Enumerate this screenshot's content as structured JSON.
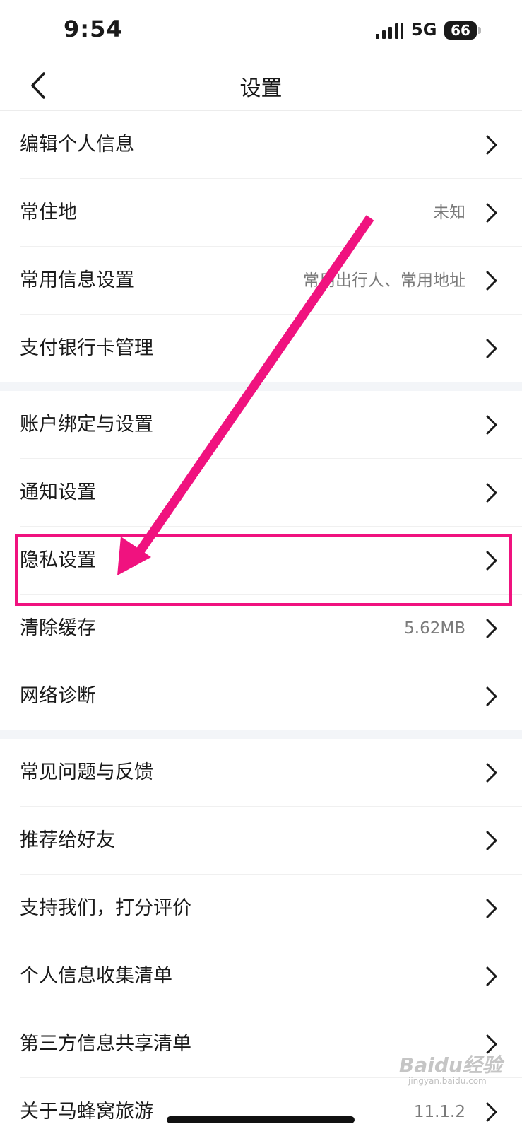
{
  "status_bar": {
    "time": "9:54",
    "network": "5G",
    "battery": "66"
  },
  "header": {
    "title": "设置"
  },
  "groups": [
    [
      {
        "label": "编辑个人信息",
        "value": ""
      },
      {
        "label": "常住地",
        "value": "未知"
      },
      {
        "label": "常用信息设置",
        "value": "常用出行人、常用地址"
      },
      {
        "label": "支付银行卡管理",
        "value": ""
      }
    ],
    [
      {
        "label": "账户绑定与设置",
        "value": ""
      },
      {
        "label": "通知设置",
        "value": ""
      },
      {
        "label": "隐私设置",
        "value": ""
      },
      {
        "label": "清除缓存",
        "value": "5.62MB"
      },
      {
        "label": "网络诊断",
        "value": ""
      }
    ],
    [
      {
        "label": "常见问题与反馈",
        "value": ""
      },
      {
        "label": "推荐给好友",
        "value": ""
      },
      {
        "label": "支持我们，打分评价",
        "value": ""
      },
      {
        "label": "个人信息收集清单",
        "value": ""
      },
      {
        "label": "第三方信息共享清单",
        "value": ""
      },
      {
        "label": "关于马蜂窝旅游",
        "value": "11.1.2"
      }
    ]
  ],
  "annotation": {
    "color": "#f0127f",
    "highlighted_item": "隐私设置"
  },
  "watermark": {
    "text": "Baidu经验",
    "sub": "jingyan.baidu.com"
  }
}
